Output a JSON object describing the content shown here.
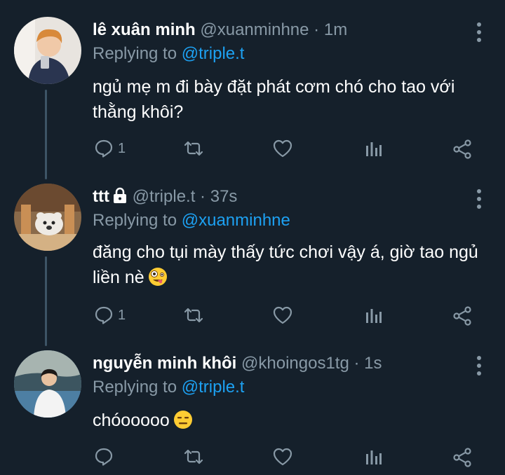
{
  "tweets": [
    {
      "name": "lê xuân minh",
      "handle": "@xuanminhne",
      "separator": "·",
      "time": "1m",
      "replying_prefix": "Replying to",
      "replying_to": "@triple.t",
      "text_line1": "ngủ mẹ m đi bày đặt phát cơm chó cho tao với",
      "text_line2": "thằng khôi?",
      "reply_count": "1",
      "retweet_count": "",
      "like_count": ""
    },
    {
      "name": "ttt",
      "protected_icon": "lock-icon",
      "handle": "@triple.t",
      "separator": "·",
      "time": "37s",
      "replying_prefix": "Replying to",
      "replying_to": "@xuanminhne",
      "text_line1": "đăng cho tụi mày thấy tức chơi vậy á, giờ tao ngủ",
      "text_line2": "liền nè",
      "emoji": "zany-face-emoji",
      "reply_count": "1",
      "retweet_count": "",
      "like_count": ""
    },
    {
      "name": "nguyễn minh khôi",
      "handle": "@khoingos1tg",
      "separator": "·",
      "time": "1s",
      "replying_prefix": "Replying to",
      "replying_to": "@triple.t",
      "text_line1": "chóooooo",
      "emoji": "expressionless-face-emoji",
      "reply_count": "",
      "retweet_count": "",
      "like_count": ""
    }
  ],
  "colors": {
    "background": "#15202b",
    "secondary_text": "#8899a6",
    "link": "#1da1f2",
    "thread_line": "#3d5466"
  }
}
